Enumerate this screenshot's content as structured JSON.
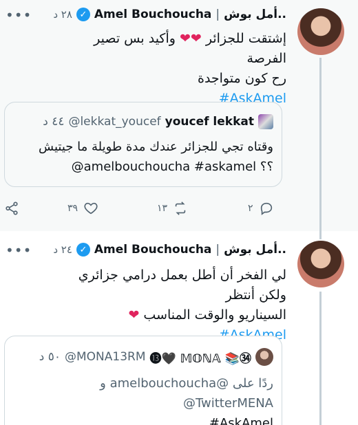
{
  "tweets": [
    {
      "author_name_ar": "..أمل بوش",
      "separator": "|",
      "author_name_en": "Amel Bouchoucha",
      "time": "٢٨ د",
      "more": "•••",
      "text_line1": "إشتقت للجزائر ❤❤ وأكيد بس تصير الفرصة",
      "text_line2": "رح كون متواجدة",
      "hashtag": "#AskAmel",
      "quote": {
        "name": "youcef lekkat",
        "handle": "@lekkat_youcef",
        "time": "٤٤ د",
        "text_line1": "وقتاه تجي للجزائر عندك مدة طويلة ما جيتيش",
        "text_line2": "@amelbouchoucha  #askamel  ؟؟"
      },
      "actions": {
        "share": "",
        "likes": "٣٩",
        "retweets": "١٣",
        "replies": "٢"
      }
    },
    {
      "author_name_ar": "..أمل بوش",
      "separator": "|",
      "author_name_en": "Amel Bouchoucha",
      "time": "٢٤ د",
      "more": "•••",
      "text_line1": "لي الفخر أن أطل بعمل درامي جزائري ولكن أنتظر",
      "text_line2": "السيناريو والوقت المناسب ❤",
      "hashtag": "#AskAmel",
      "quote": {
        "name": "⓭🖤 𝕄𝕆ℕ𝔸 📚㉞",
        "handle": "@MONA13RM",
        "time": "٥٠ د",
        "text_line1": "ردًا على @amelbouchoucha و",
        "text_line2": "@TwitterMENA",
        "text_line3": "#AskAmel"
      }
    }
  ]
}
